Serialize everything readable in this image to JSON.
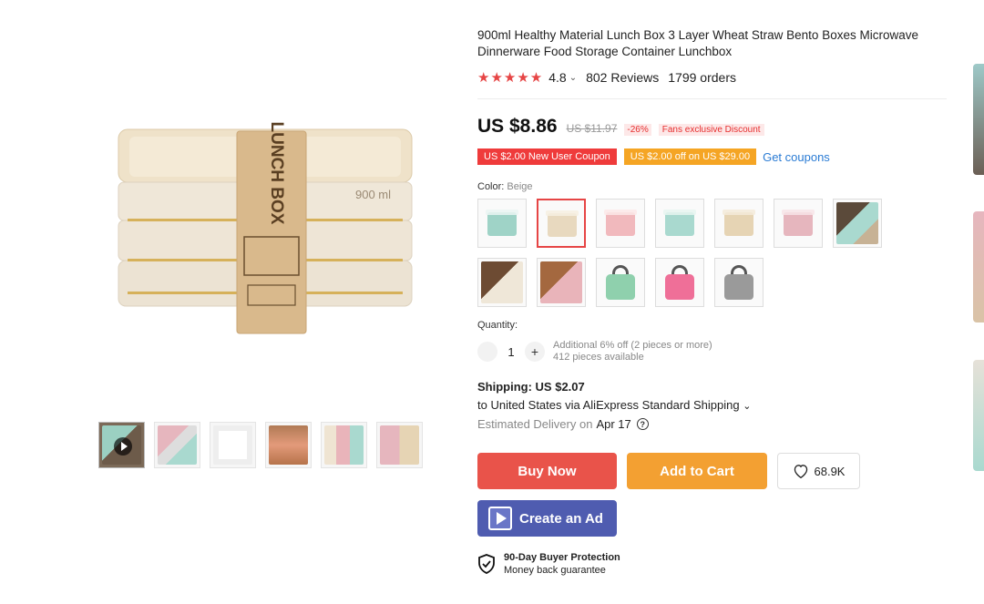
{
  "product": {
    "title": "900ml Healthy Material Lunch Box 3 Layer Wheat Straw Bento Boxes Microwave Dinnerware Food Storage Container Lunchbox",
    "stars": "★★★★★",
    "rating": "4.8",
    "reviews": "802 Reviews",
    "orders": "1799 orders"
  },
  "main_image": {
    "brand_text": "LUNCH BOX",
    "lid_text": "900 ml"
  },
  "price": {
    "current": "US $8.86",
    "original": "US $11.97",
    "discount": "-26%",
    "fans_label": "Fans exclusive Discount"
  },
  "coupons": {
    "new_user": "US $2.00 New User Coupon",
    "off": "US $2.00 off on US $29.00",
    "get_label": "Get coupons"
  },
  "color": {
    "label": "Color:",
    "selected": "Beige",
    "options": [
      {
        "name": "green-box-swatch",
        "tone": "#9fd3c7"
      },
      {
        "name": "beige-box-swatch",
        "tone": "#e8d9bf"
      },
      {
        "name": "pink-box-swatch",
        "tone": "#f1b9bd"
      },
      {
        "name": "mint-box-swatch",
        "tone": "#a9d9cf"
      },
      {
        "name": "beige-box-swatch-2",
        "tone": "#e6d4b4"
      },
      {
        "name": "pink-box-swatch-2",
        "tone": "#e6b6be"
      },
      {
        "name": "scene-swatch-1",
        "tone": "#7a6a58"
      },
      {
        "name": "scene-swatch-2",
        "tone": "#8b5a3c"
      },
      {
        "name": "scene-swatch-3",
        "tone": "#a4683f"
      },
      {
        "name": "green-bag-swatch",
        "tone": "#8fd0ad"
      },
      {
        "name": "pink-bag-swatch",
        "tone": "#ef6f98"
      },
      {
        "name": "gray-bag-swatch",
        "tone": "#9a9a9a"
      }
    ]
  },
  "quantity": {
    "label": "Quantity:",
    "minus": "",
    "value": "1",
    "plus": "+",
    "note_line1": "Additional 6% off (2 pieces or more)",
    "note_line2": "412 pieces available"
  },
  "shipping": {
    "title": "Shipping: US $2.07",
    "route": "to United States via AliExpress Standard Shipping",
    "chevron": "⌄",
    "delivery_label": "Estimated Delivery on",
    "delivery_date": "Apr 17",
    "help": "?"
  },
  "actions": {
    "buy_now": "Buy Now",
    "add_to_cart": "Add to Cart",
    "wishlist_count": "68.9K",
    "create_ad": "Create an Ad"
  },
  "protection": {
    "title": "90-Day Buyer Protection",
    "subtitle": "Money back guarantee"
  },
  "colors": {
    "accent_red": "#e9534a",
    "accent_orange": "#f3a032",
    "ad_blue": "#4f5cb0",
    "link_blue": "#2a7bd4"
  }
}
